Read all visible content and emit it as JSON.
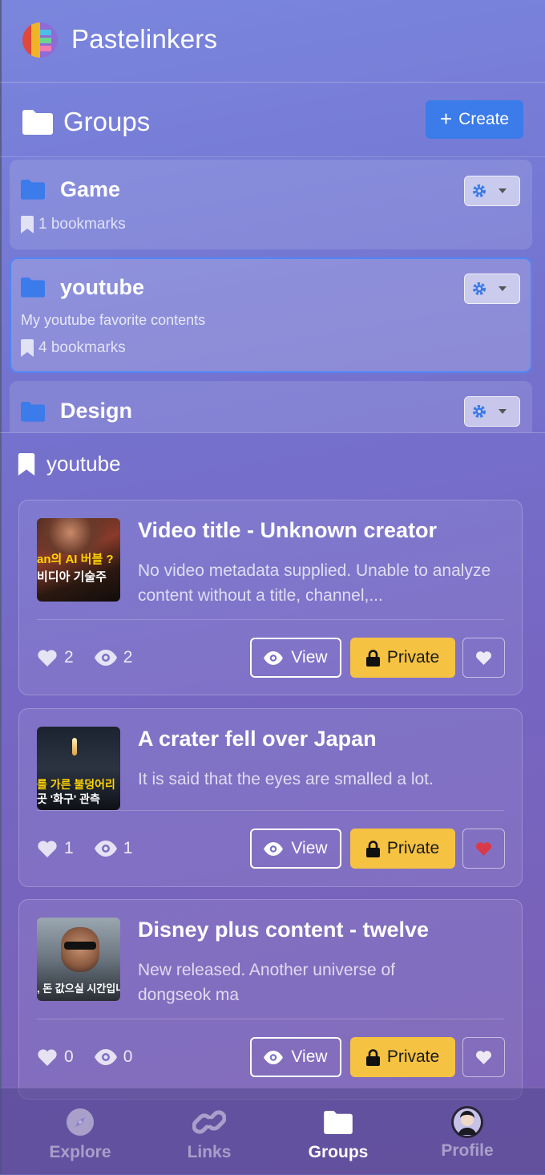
{
  "app": {
    "title": "Pastelinkers"
  },
  "groups_section": {
    "title": "Groups",
    "create_label": "Create"
  },
  "groups": [
    {
      "name": "Game",
      "description": "",
      "bookmarks": "1 bookmarks",
      "selected": false
    },
    {
      "name": "youtube",
      "description": "My youtube favorite contents",
      "bookmarks": "4 bookmarks",
      "selected": true
    },
    {
      "name": "Design",
      "description": "",
      "bookmarks": "",
      "selected": false
    }
  ],
  "selected_group": {
    "title": "youtube"
  },
  "bookmarks": [
    {
      "title": "Video title - Unknown creator",
      "description": "No video metadata supplied. Unable to analyze content without a title, channel,...",
      "likes": "2",
      "views": "2",
      "view_label": "View",
      "private_label": "Private",
      "liked": false,
      "thumb_text": [
        "an의 AI 버블 ?",
        "비디아 기술주"
      ]
    },
    {
      "title": "A crater fell over Japan",
      "description": "It is said that the eyes are smalled a lot.",
      "likes": "1",
      "views": "1",
      "view_label": "View",
      "private_label": "Private",
      "liked": true,
      "thumb_text": [
        "를 가른 불덩어리",
        "곳 '화구' 관측"
      ]
    },
    {
      "title": "Disney plus content - twelve",
      "description": "New released. Another universe of dongseok ma",
      "likes": "0",
      "views": "0",
      "view_label": "View",
      "private_label": "Private",
      "liked": false,
      "thumb_text": [
        ", 돈 값으실 시간입니"
      ]
    }
  ],
  "tabs": [
    {
      "label": "Explore",
      "icon": "compass-icon",
      "active": false
    },
    {
      "label": "Links",
      "icon": "link-icon",
      "active": false
    },
    {
      "label": "Groups",
      "icon": "folder-icon",
      "active": true
    },
    {
      "label": "Profile",
      "icon": "avatar",
      "active": false
    }
  ],
  "colors": {
    "accent": "#3b7bea",
    "private": "#f5c242",
    "liked": "#d83a4a",
    "folder": "#3b7bea"
  }
}
